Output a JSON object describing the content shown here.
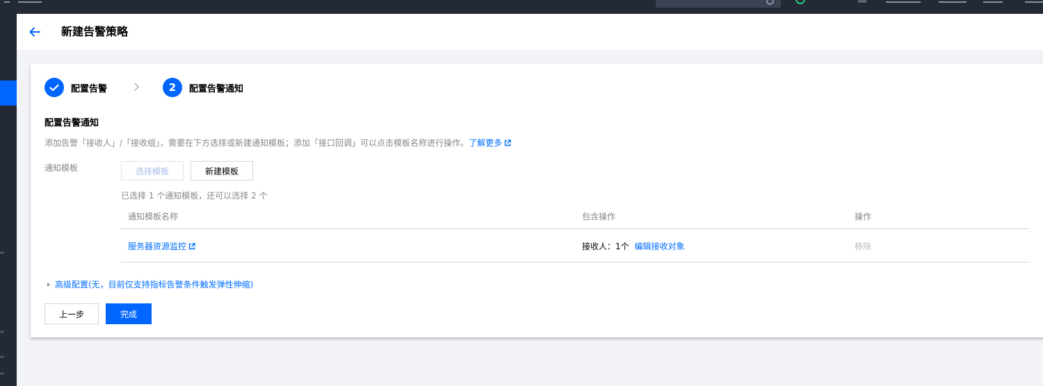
{
  "header": {
    "title": "新建告警策略"
  },
  "steps": [
    {
      "label": "配置告警",
      "state": "done"
    },
    {
      "number": "2",
      "label": "配置告警通知",
      "state": "current"
    }
  ],
  "section": {
    "title": "配置告警通知",
    "description": "添加告警「接收人」/「接收组」，需要在下方选择或新建通知模板；添加「接口回调」可以点击模板名称进行操作。",
    "learn_more": "了解更多"
  },
  "template_field": {
    "label": "通知模板",
    "select_button": "选择模板",
    "new_button": "新建模板",
    "hint": "已选择 1 个通知模板，还可以选择 2 个"
  },
  "table": {
    "columns": [
      "通知模板名称",
      "包含操作",
      "操作"
    ],
    "rows": [
      {
        "name": "服务器资源监控",
        "receivers": "接收人：1个",
        "edit_link": "编辑接收对象",
        "action": "移除"
      }
    ]
  },
  "advanced": {
    "label": "高级配置(无，目前仅支持指标告警条件触发弹性伸缩)"
  },
  "footer": {
    "prev_button": "上一步",
    "finish_button": "完成"
  },
  "colors": {
    "primary": "#0066ff",
    "link": "#006eff",
    "topbar": "#232a36",
    "page_bg": "#f2f3f6",
    "status_green": "#29cc85"
  }
}
